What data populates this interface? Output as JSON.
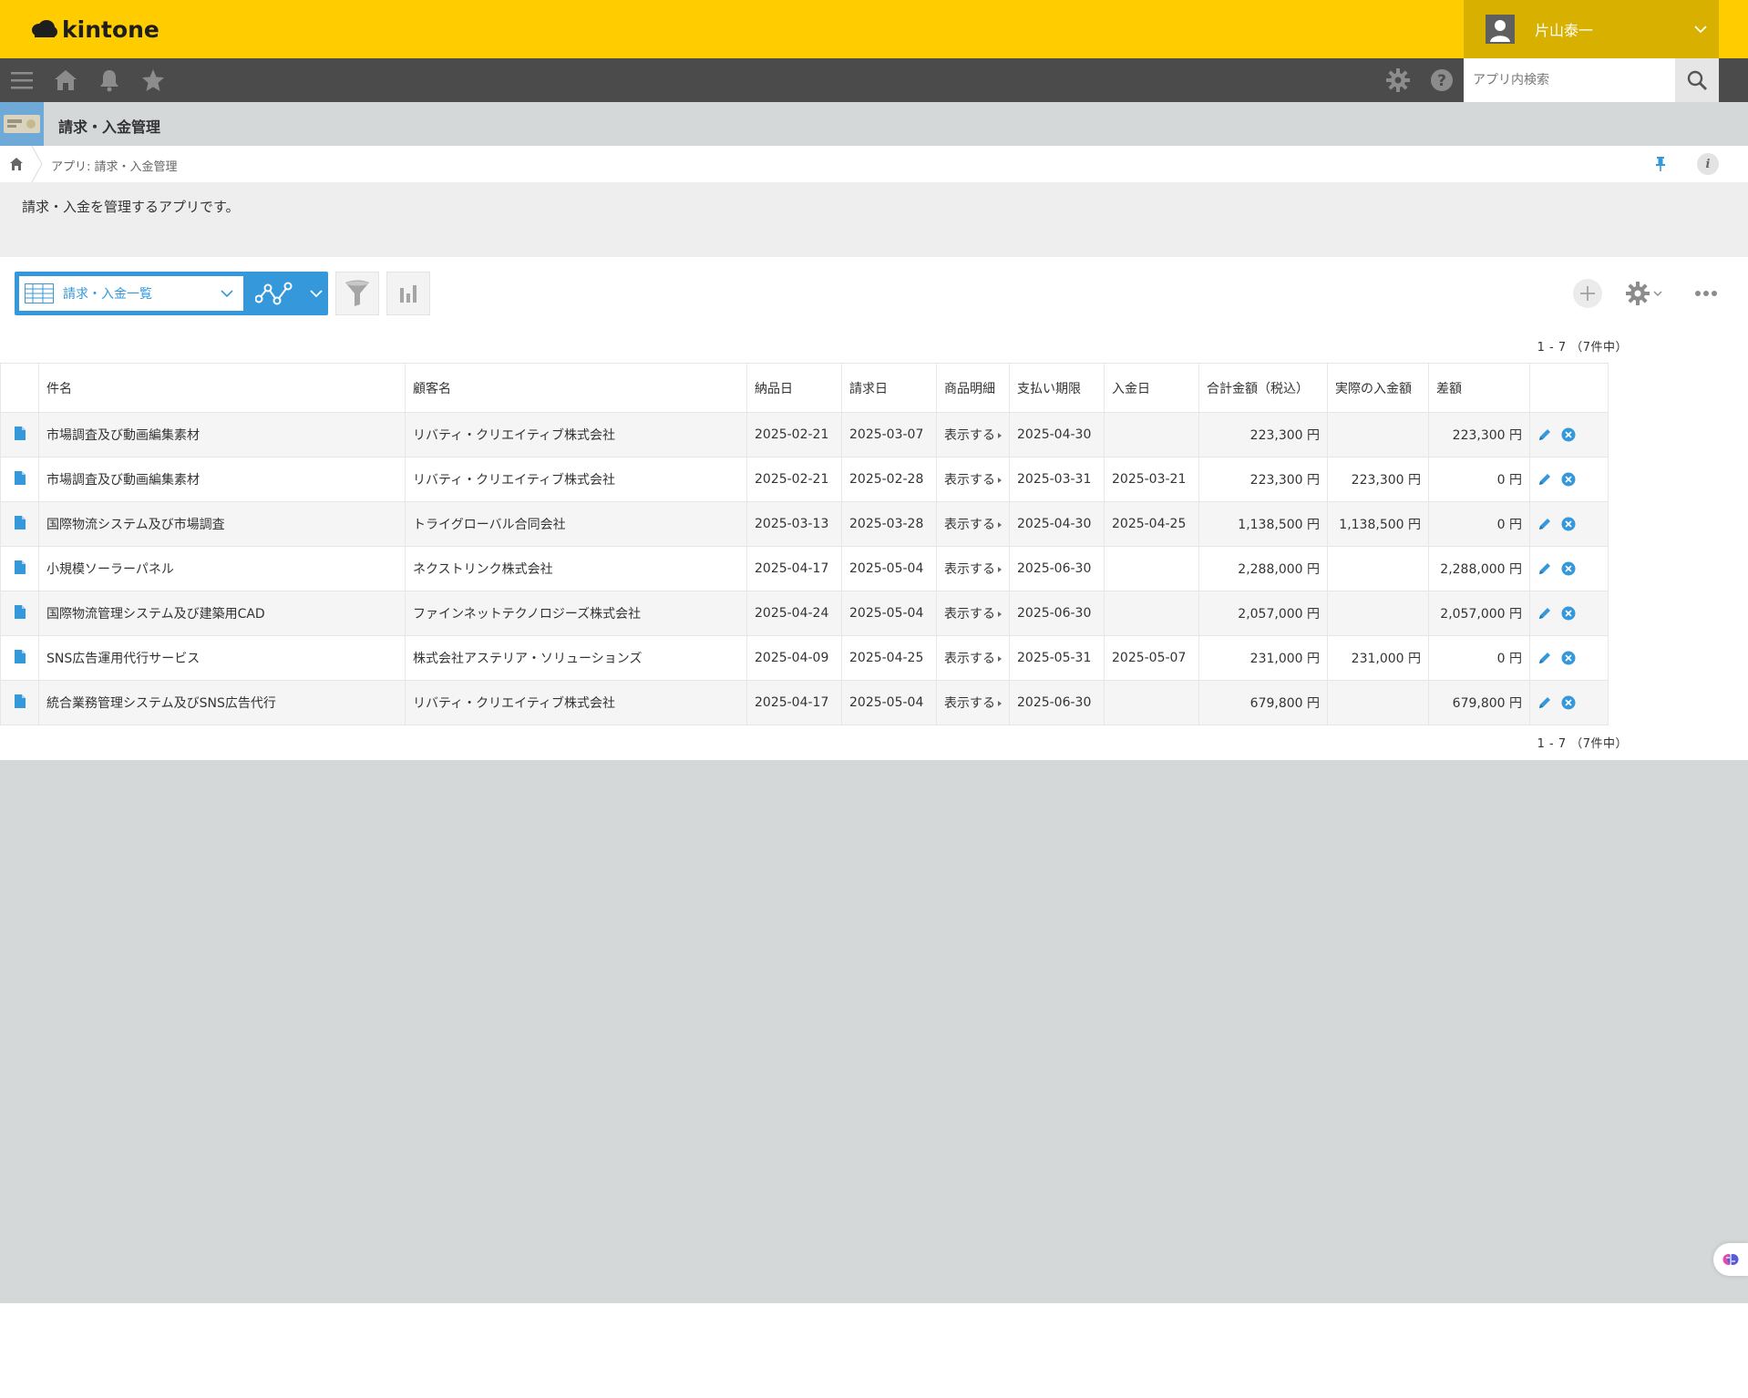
{
  "header": {
    "logo_text": "kintone",
    "user_name": "片山泰一",
    "brand_color": "#ffcc00"
  },
  "gnav": {
    "search_placeholder": "アプリ内検索"
  },
  "app": {
    "title": "請求・入金管理",
    "breadcrumb": "アプリ: 請求・入金管理",
    "description": "請求・入金を管理するアプリです。"
  },
  "toolbar": {
    "view_name": "請求・入金一覧",
    "pager_top": "1 - 7 （7件中）",
    "pager_bottom": "1 - 7 （7件中）"
  },
  "table": {
    "columns": [
      "件名",
      "顧客名",
      "納品日",
      "請求日",
      "商品明細",
      "支払い期限",
      "入金日",
      "合計金額（税込）",
      "実際の入金額",
      "差額"
    ],
    "rows": [
      {
        "name": "市場調査及び動画編集素材",
        "customer": "リバティ・クリエイティブ株式会社",
        "delivery": "2025-02-21",
        "billing": "2025-03-07",
        "detail": "表示する",
        "due": "2025-04-30",
        "paid_date": "",
        "total": "223,300 円",
        "paid": "",
        "diff": "223,300 円"
      },
      {
        "name": "市場調査及び動画編集素材",
        "customer": "リバティ・クリエイティブ株式会社",
        "delivery": "2025-02-21",
        "billing": "2025-02-28",
        "detail": "表示する",
        "due": "2025-03-31",
        "paid_date": "2025-03-21",
        "total": "223,300 円",
        "paid": "223,300 円",
        "diff": "0 円"
      },
      {
        "name": "国際物流システム及び市場調査",
        "customer": "トライグローバル合同会社",
        "delivery": "2025-03-13",
        "billing": "2025-03-28",
        "detail": "表示する",
        "due": "2025-04-30",
        "paid_date": "2025-04-25",
        "total": "1,138,500 円",
        "paid": "1,138,500 円",
        "diff": "0 円"
      },
      {
        "name": "小規模ソーラーパネル",
        "customer": "ネクストリンク株式会社",
        "delivery": "2025-04-17",
        "billing": "2025-05-04",
        "detail": "表示する",
        "due": "2025-06-30",
        "paid_date": "",
        "total": "2,288,000 円",
        "paid": "",
        "diff": "2,288,000 円"
      },
      {
        "name": "国際物流管理システム及び建築用CAD",
        "customer": "ファインネットテクノロジーズ株式会社",
        "delivery": "2025-04-24",
        "billing": "2025-05-04",
        "detail": "表示する",
        "due": "2025-06-30",
        "paid_date": "",
        "total": "2,057,000 円",
        "paid": "",
        "diff": "2,057,000 円"
      },
      {
        "name": "SNS広告運用代行サービス",
        "customer": "株式会社アステリア・ソリューションズ",
        "delivery": "2025-04-09",
        "billing": "2025-04-25",
        "detail": "表示する",
        "due": "2025-05-31",
        "paid_date": "2025-05-07",
        "total": "231,000 円",
        "paid": "231,000 円",
        "diff": "0 円"
      },
      {
        "name": "統合業務管理システム及びSNS広告代行",
        "customer": "リバティ・クリエイティブ株式会社",
        "delivery": "2025-04-17",
        "billing": "2025-05-04",
        "detail": "表示する",
        "due": "2025-06-30",
        "paid_date": "",
        "total": "679,800 円",
        "paid": "",
        "diff": "679,800 円"
      }
    ]
  },
  "colors": {
    "accent": "#3498db",
    "nav_bg": "#4b4b4b",
    "app_header_bg": "#d5d8d9"
  }
}
